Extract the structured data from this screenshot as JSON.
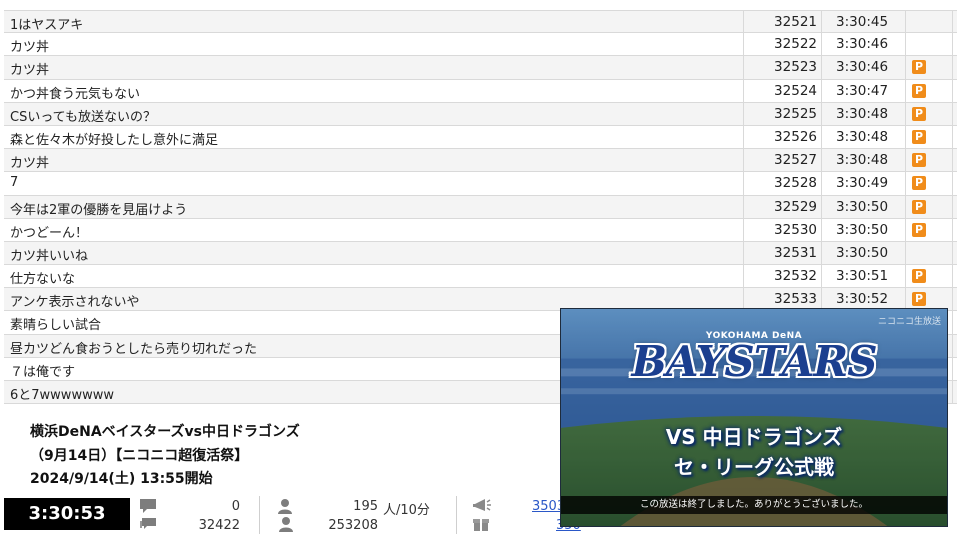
{
  "comments": [
    {
      "text": "1はヤスアキ",
      "num": "32521",
      "time": "3:30:45",
      "premium": false
    },
    {
      "text": "カツ丼",
      "num": "32522",
      "time": "3:30:46",
      "premium": false
    },
    {
      "text": "カツ丼",
      "num": "32523",
      "time": "3:30:46",
      "premium": true
    },
    {
      "text": "かつ丼食う元気もない",
      "num": "32524",
      "time": "3:30:47",
      "premium": true
    },
    {
      "text": "CSいっても放送ないの？",
      "num": "32525",
      "time": "3:30:48",
      "premium": true
    },
    {
      "text": "森と佐々木が好投したし意外に満足",
      "num": "32526",
      "time": "3:30:48",
      "premium": true
    },
    {
      "text": "カツ丼",
      "num": "32527",
      "time": "3:30:48",
      "premium": true
    },
    {
      "text": "7",
      "num": "32528",
      "time": "3:30:49",
      "premium": true
    },
    {
      "text": "今年は2軍の優勝を見届けよう",
      "num": "32529",
      "time": "3:30:50",
      "premium": true
    },
    {
      "text": "かつどーん！",
      "num": "32530",
      "time": "3:30:50",
      "premium": true
    },
    {
      "text": "カツ丼いいね",
      "num": "32531",
      "time": "3:30:50",
      "premium": false
    },
    {
      "text": "仕方ないな",
      "num": "32532",
      "time": "3:30:51",
      "premium": true
    },
    {
      "text": "アンケ表示されないや",
      "num": "32533",
      "time": "3:30:52",
      "premium": true
    },
    {
      "text": "素晴らしい試合",
      "num": "",
      "time": "",
      "premium": false
    },
    {
      "text": "昼カツどん食おうとしたら売り切れだった",
      "num": "",
      "time": "",
      "premium": false
    },
    {
      "text": "７は俺です",
      "num": "",
      "time": "",
      "premium": false
    },
    {
      "text": "6と7wwwwwww",
      "num": "",
      "time": "",
      "premium": false
    }
  ],
  "premium_badge": "P",
  "program": {
    "title": "横浜DeNAベイスターズvs中日ドラゴンズ",
    "subtitle": "（9月14日）【ニコニコ超復活祭】",
    "start": "2024/9/14(土) 13:55開始"
  },
  "status": {
    "timer": "3:30:53",
    "comment_count_top": "0",
    "comment_count_bottom": "32422",
    "viewers_top": "195",
    "viewers_unit": "人/10分",
    "viewers_bottom": "253208",
    "ad_points_partial": "3503",
    "gift_points_partial": "350"
  },
  "player": {
    "watermark": "ニコニコ生放送",
    "logo_small": "YOKOHAMA DeNA",
    "logo_main": "BAYSTARS",
    "vs_line": "VS 中日ドラゴンズ",
    "league_line": "セ・リーグ公式戦",
    "end_message": "この放送は終了しました。ありがとうございました。"
  },
  "colors": {
    "premium_badge": "#f08c1a",
    "timer_bg": "#000000",
    "link": "#2a57c7",
    "team_blue": "#1b3f8f"
  },
  "icons": [
    "comment-icon",
    "viewer-icon",
    "ad-icon",
    "gift-icon"
  ]
}
